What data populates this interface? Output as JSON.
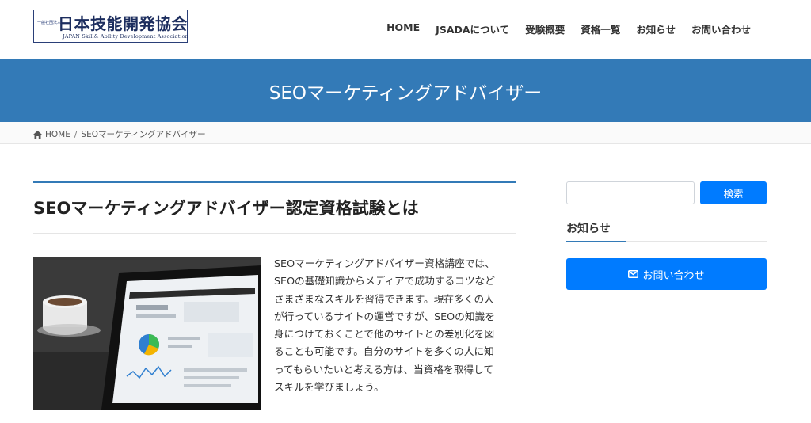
{
  "header": {
    "logo": {
      "small_text": "一般社団法人",
      "main_text": "日本技能開発協会",
      "sub_text": "JAPAN Skill& Ability Development Association"
    },
    "nav": [
      {
        "label": "HOME"
      },
      {
        "label": "JSADAについて"
      },
      {
        "label": "受験概要"
      },
      {
        "label": "資格一覧"
      },
      {
        "label": "お知らせ"
      },
      {
        "label": "お問い合わせ"
      }
    ]
  },
  "page_title": "SEOマーケティングアドバイザー",
  "breadcrumb": {
    "home_label": "HOME",
    "separator": "/",
    "current": "SEOマーケティングアドバイザー"
  },
  "main": {
    "heading": "SEOマーケティングアドバイザー認定資格試験とは",
    "image_icon": "tablet-analytics-photo",
    "body_lines": [
      "SEOマーケティングアドバイザー資格講座では、",
      "SEOの基礎知識からメディアで成功するコツなど",
      "さまざまなスキルを習得できます。現在多くの人",
      "が行っているサイトの運営ですが、SEOの知識を",
      "身につけておくことで他のサイトとの差別化を図",
      "ることも可能です。自分のサイトを多くの人に知",
      "ってもらいたいと考える方は、当資格を取得して",
      "スキルを学びましょう。"
    ]
  },
  "sidebar": {
    "search": {
      "placeholder": "",
      "value": "",
      "button_label": "検索"
    },
    "widget_title": "お知らせ",
    "contact_button": {
      "label": "お問い合わせ",
      "icon": "envelope-icon"
    }
  },
  "colors": {
    "title_band": "#337ab7",
    "button_primary": "#007bff",
    "logo_navy": "#1c2d5e"
  }
}
